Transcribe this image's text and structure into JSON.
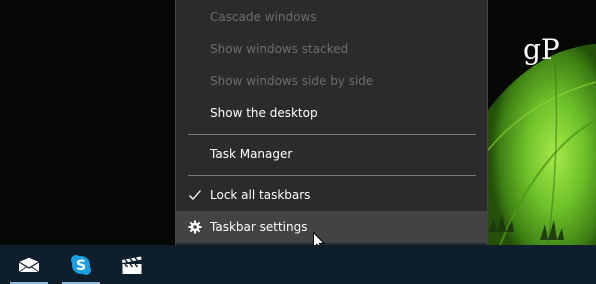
{
  "watermark": {
    "text": "gP"
  },
  "context_menu": {
    "items": [
      {
        "label": "Cascade windows",
        "enabled": false
      },
      {
        "label": "Show windows stacked",
        "enabled": false
      },
      {
        "label": "Show windows side by side",
        "enabled": false
      },
      {
        "label": "Show the desktop",
        "enabled": true
      },
      {
        "label": "Task Manager",
        "enabled": true
      },
      {
        "label": "Lock all taskbars",
        "enabled": true,
        "checked": true,
        "icon": "checkmark-icon"
      },
      {
        "label": "Taskbar settings",
        "enabled": true,
        "hovered": true,
        "icon": "gear-icon"
      }
    ]
  },
  "taskbar": {
    "apps": [
      {
        "name": "Mail",
        "icon": "mail-icon",
        "active": true
      },
      {
        "name": "Skype",
        "icon": "skype-icon",
        "active": true
      },
      {
        "name": "Movies & TV",
        "icon": "clapperboard-icon",
        "active": false
      }
    ]
  },
  "colors": {
    "menu_background": "#2b2b2b",
    "menu_hover": "#434343",
    "disabled_text": "#6d6d6d",
    "taskbar": "#0f1e2d",
    "taskbar_active_indicator": "#8ab4d8",
    "skype_blue": "#1a9fe0",
    "wallpaper_green": "#6fc22a"
  }
}
